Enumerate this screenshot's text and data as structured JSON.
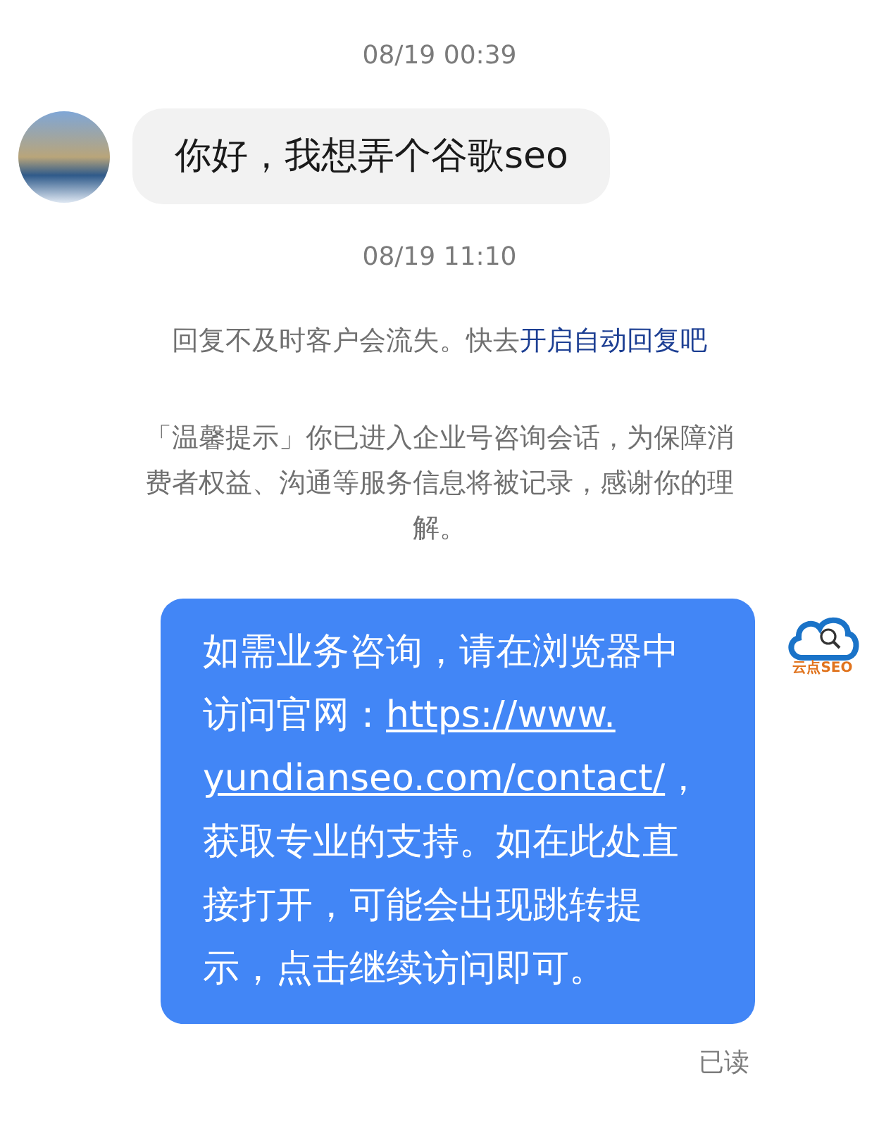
{
  "messages": [
    {
      "kind": "time",
      "text": "08/19 00:39"
    },
    {
      "kind": "incoming",
      "text": "你好，我想弄个谷歌seo"
    },
    {
      "kind": "time",
      "text": "08/19 11:10"
    },
    {
      "kind": "tip",
      "text": "回复不及时客户会流失。快去",
      "link": "开启自动回复吧"
    },
    {
      "kind": "notice",
      "text": "「温馨提示」你已进入企业号咨询会话，为保障消费者权益、沟通等服务信息将被记录，感谢你的理解。"
    },
    {
      "kind": "outgoing",
      "before": "如需业务咨询，请在浏览器中访问官网：",
      "link_lines": [
        "https://www.",
        "yundianseo.com/contact/"
      ],
      "after": "，获取专业的支持。如在此处直接打开，可能会出现跳转提示，点击继续访问即可。",
      "avatar_label": "云点SEO"
    }
  ],
  "read_status": "已读"
}
